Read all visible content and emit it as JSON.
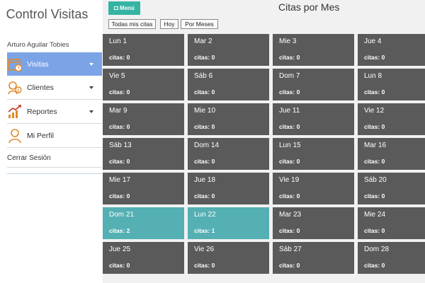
{
  "sidebar": {
    "title": "Control Visitas",
    "user": "Arturo Aguilar Tobies",
    "items": [
      {
        "label": "Visitas",
        "icon": "calendar-icon"
      },
      {
        "label": "Clientes",
        "icon": "clients-icon"
      },
      {
        "label": "Reportes",
        "icon": "chart-icon"
      },
      {
        "label": "Mi Perfil",
        "icon": "user-icon"
      }
    ],
    "logout": "Cerrar Sesión"
  },
  "header": {
    "menu_label": "Menú",
    "title": "Citas por Mes"
  },
  "filters": [
    "Todas mis citas",
    "Hoy",
    "Por Meses"
  ],
  "calendar": {
    "days": [
      {
        "label": "Lun 1",
        "count": "citas: 0"
      },
      {
        "label": "Mar 2",
        "count": "citas: 0"
      },
      {
        "label": "Mie 3",
        "count": "citas: 0"
      },
      {
        "label": "Jue 4",
        "count": "citas: 0"
      },
      {
        "label": "Vie 5",
        "count": "citas: 0"
      },
      {
        "label": "Sáb 6",
        "count": "citas: 0"
      },
      {
        "label": "Dom 7",
        "count": "citas: 0"
      },
      {
        "label": "Lun 8",
        "count": "citas: 0"
      },
      {
        "label": "Mar 9",
        "count": "citas: 0"
      },
      {
        "label": "Mie 10",
        "count": "citas: 0"
      },
      {
        "label": "Jue 11",
        "count": "citas: 0"
      },
      {
        "label": "Vie 12",
        "count": "citas: 0"
      },
      {
        "label": "Sáb 13",
        "count": "citas: 0"
      },
      {
        "label": "Dom 14",
        "count": "citas: 0"
      },
      {
        "label": "Lun 15",
        "count": "citas: 0"
      },
      {
        "label": "Mar 16",
        "count": "citas: 0"
      },
      {
        "label": "Mie 17",
        "count": "citas: 0"
      },
      {
        "label": "Jue 18",
        "count": "citas: 0"
      },
      {
        "label": "Vie 19",
        "count": "citas: 0"
      },
      {
        "label": "Sáb 20",
        "count": "citas: 0"
      },
      {
        "label": "Dom 21",
        "count": "citas: 2",
        "highlight": true
      },
      {
        "label": "Lun 22",
        "count": "citas: 1",
        "highlight": true
      },
      {
        "label": "Mar 23",
        "count": "citas: 0"
      },
      {
        "label": "Mie 24",
        "count": "citas: 0"
      },
      {
        "label": "Jue 25",
        "count": "citas: 0"
      },
      {
        "label": "Vie 26",
        "count": "citas: 0"
      },
      {
        "label": "Sáb 27",
        "count": "citas: 0"
      },
      {
        "label": "Dom 28",
        "count": "citas: 0"
      }
    ]
  },
  "colors": {
    "accent": "#35b3a3",
    "active_nav": "#7ba3e6",
    "cell": "#5a5a5a",
    "cell_highlight": "#54b0b3",
    "icon": "#e08a2a"
  }
}
